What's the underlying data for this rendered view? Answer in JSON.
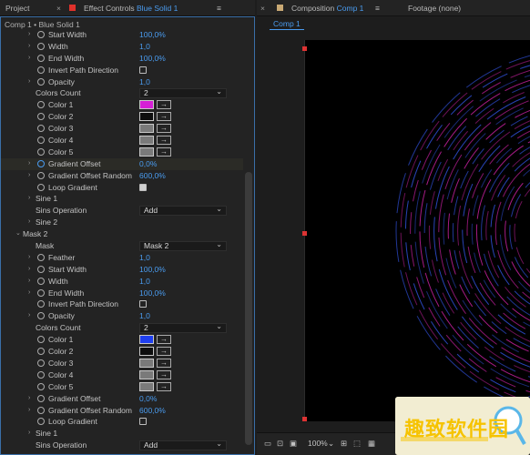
{
  "left_tabs": {
    "project": "Project",
    "effect_controls_prefix": "Effect Controls",
    "effect_controls_layer": "Blue Solid 1",
    "menu": "≡"
  },
  "right_tabs": {
    "composition_prefix": "Composition",
    "composition_name": "Comp 1",
    "menu": "≡",
    "footage": "Footage (none)"
  },
  "comp_path": "Comp 1 • Blue Solid 1",
  "rows": [
    {
      "type": "val",
      "label": "Start Width",
      "value": "100,0%",
      "tw": true
    },
    {
      "type": "val",
      "label": "Width",
      "value": "1,0",
      "tw": true
    },
    {
      "type": "val",
      "label": "End Width",
      "value": "100,0%",
      "tw": true
    },
    {
      "type": "chk",
      "label": "Invert Path Direction",
      "checked": false
    },
    {
      "type": "val",
      "label": "Opacity",
      "value": "1,0",
      "tw": true
    },
    {
      "type": "dd",
      "label": "Colors Count",
      "value": "2"
    },
    {
      "type": "color",
      "label": "Color 1",
      "swatch": "#d61fd6"
    },
    {
      "type": "color",
      "label": "Color 2",
      "swatch": "#0e0e0e"
    },
    {
      "type": "color",
      "label": "Color 3",
      "swatch": "#7a7a7a"
    },
    {
      "type": "color",
      "label": "Color 4",
      "swatch": "#7a7a7a"
    },
    {
      "type": "color",
      "label": "Color 5",
      "swatch": "#7a7a7a"
    },
    {
      "type": "val",
      "label": "Gradient Offset",
      "value": "0,0%",
      "tw": true,
      "sel": true,
      "blueStop": true
    },
    {
      "type": "val",
      "label": "Gradient Offset Random",
      "value": "600,0%",
      "tw": true
    },
    {
      "type": "chk",
      "label": "Loop Gradient",
      "checked": true
    },
    {
      "type": "group",
      "label": "Sine 1"
    },
    {
      "type": "dd",
      "label": "Sins Operation",
      "value": "Add"
    },
    {
      "type": "group",
      "label": "Sine 2"
    },
    {
      "type": "section",
      "label": "Mask 2"
    },
    {
      "type": "dd",
      "label": "Mask",
      "value": "Mask 2"
    },
    {
      "type": "val",
      "label": "Feather",
      "value": "1,0",
      "tw": true
    },
    {
      "type": "val",
      "label": "Start Width",
      "value": "100,0%",
      "tw": true
    },
    {
      "type": "val",
      "label": "Width",
      "value": "1,0",
      "tw": true
    },
    {
      "type": "val",
      "label": "End Width",
      "value": "100,0%",
      "tw": true
    },
    {
      "type": "chk",
      "label": "Invert Path Direction",
      "checked": false
    },
    {
      "type": "val",
      "label": "Opacity",
      "value": "1,0",
      "tw": true
    },
    {
      "type": "dd",
      "label": "Colors Count",
      "value": "2"
    },
    {
      "type": "color",
      "label": "Color 1",
      "swatch": "#1f3ff0"
    },
    {
      "type": "color",
      "label": "Color 2",
      "swatch": "#0e0e0e"
    },
    {
      "type": "color",
      "label": "Color 3",
      "swatch": "#7a7a7a"
    },
    {
      "type": "color",
      "label": "Color 4",
      "swatch": "#7a7a7a"
    },
    {
      "type": "color",
      "label": "Color 5",
      "swatch": "#7a7a7a"
    },
    {
      "type": "val",
      "label": "Gradient Offset",
      "value": "0,0%",
      "tw": true
    },
    {
      "type": "val",
      "label": "Gradient Offset Random",
      "value": "600,0%",
      "tw": true
    },
    {
      "type": "chk",
      "label": "Loop Gradient",
      "checked": false
    },
    {
      "type": "group",
      "label": "Sine 1"
    },
    {
      "type": "dd",
      "label": "Sins Operation",
      "value": "Add"
    }
  ],
  "viewer": {
    "zoom": "100%"
  },
  "watermark": {
    "text": "趣致软件园"
  },
  "colors": {
    "accent": "#4a9cf0",
    "ring_pink": "#c2209c",
    "ring_blue": "#2f4fd6",
    "handle": "#dd3333"
  }
}
